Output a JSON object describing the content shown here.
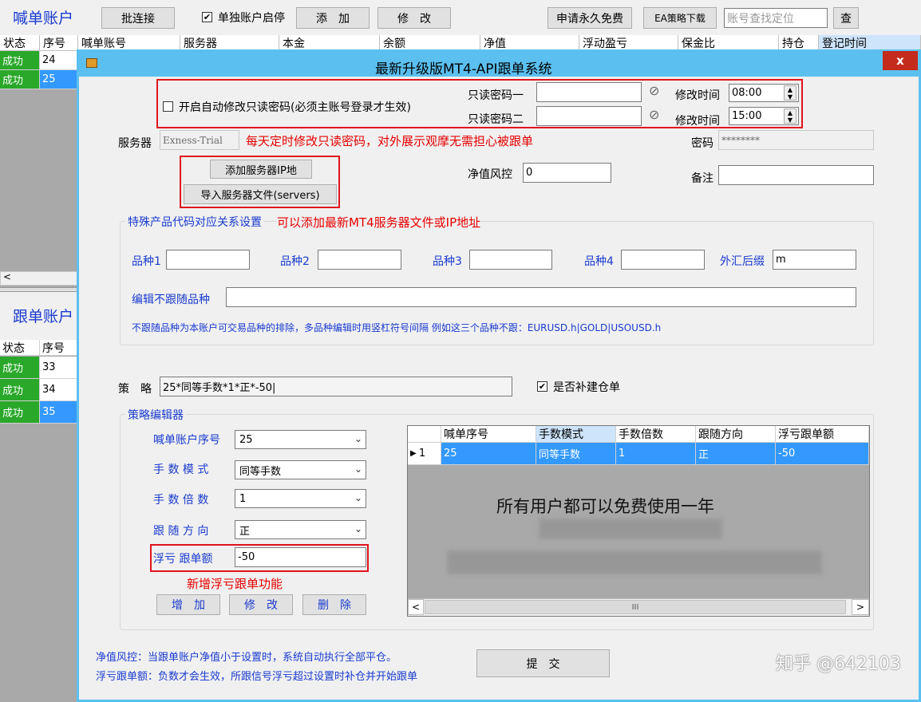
{
  "toolbar": {
    "title": "喊单账户",
    "batch_connect": "批连接",
    "single_toggle_label": "单独账户启停",
    "add": "添　加",
    "modify": "修　改",
    "apply_free": "申请永久免费",
    "ea_download": "EA策略下载",
    "search_placeholder": "账号查找定位",
    "search_button": "查"
  },
  "caller_grid": {
    "columns": [
      "状态",
      "序号",
      "喊单账号",
      "服务器",
      "本金",
      "余额",
      "净值",
      "浮动盈亏",
      "保金比",
      "持仓",
      "登记时间"
    ],
    "rows": [
      {
        "status": "成功",
        "index": "24"
      },
      {
        "status": "成功",
        "index": "25"
      }
    ]
  },
  "follower_panel": {
    "title": "跟单账户",
    "columns": [
      "状态",
      "序号"
    ],
    "rows": [
      {
        "status": "成功",
        "index": "33"
      },
      {
        "status": "成功",
        "index": "34"
      },
      {
        "status": "成功",
        "index": "35"
      }
    ]
  },
  "dialog": {
    "title": "最新升级版MT4-API跟单系统",
    "close": "x",
    "auto_pwd_label": "开启自动修改只读密码(必须主账号登录才生效)",
    "ro_pwd1_label": "只读密码一",
    "ro_pwd2_label": "只读密码二",
    "modify_time_label": "修改时间",
    "time1": "08:00",
    "time2": "15:00",
    "server_label": "服务器",
    "server_value": "Exness-Trial",
    "server_note": "每天定时修改只读密码，对外展示观摩无需担心被跟单",
    "password_label": "密码",
    "password_value": "********",
    "add_server_ip": "添加服务器IP地",
    "import_server_file": "导入服务器文件(servers)",
    "equity_risk_label": "净值风控",
    "equity_risk_value": "0",
    "note_label": "备注",
    "special_group_title": "特殊产品代码对应关系设置",
    "special_note": "可以添加最新MT4服务器文件或IP地址",
    "symbol1_label": "品种1",
    "symbol2_label": "品种2",
    "symbol3_label": "品种3",
    "symbol4_label": "品种4",
    "fx_suffix_label": "外汇后缀",
    "fx_suffix_value": "m",
    "exclude_label": "编辑不跟随品种",
    "exclude_hint": "不跟随品种为本账户可交易品种的排除，多品种编辑时用竖杠符号间隔   例如这三个品种不跟：EURUSD.h|GOLD|USOUSD.h",
    "strategy_label": "策　略",
    "strategy_value": "25*同等手数*1*正*-50|",
    "refill_label": "是否补建仓单",
    "editor_title": "策略编辑器",
    "caller_index_label": "喊单账户序号",
    "caller_index_value": "25",
    "lot_mode_label": "手 数 模 式",
    "lot_mode_value": "同等手数",
    "lot_multiplier_label": "手 数 倍 数",
    "lot_multiplier_value": "1",
    "follow_dir_label": "跟 随 方 向",
    "follow_dir_value": "正",
    "float_loss_label": "浮亏 跟单额",
    "float_loss_value": "-50",
    "new_feature_note": "新增浮亏跟单功能",
    "btn_add": "增　加",
    "btn_modify": "修　改",
    "btn_delete": "删　除",
    "table_columns": [
      "喊单序号",
      "手数模式",
      "手数倍数",
      "跟随方向",
      "浮亏跟单额"
    ],
    "table_row": {
      "rownum": "1",
      "caller": "25",
      "mode": "同等手数",
      "mult": "1",
      "dir": "正",
      "amount": "-50"
    },
    "overlay_text": "所有用户都可以免费使用一年",
    "scroll_mid": "III",
    "footer_line1": "净值风控：当跟单账户净值小于设置时，系统自动执行全部平仓。",
    "footer_line2": "浮亏跟单额：负数才会生效，所跟信号浮亏超过设置时补仓并开始跟单",
    "submit": "提　交"
  },
  "watermark": "知乎 @642103"
}
